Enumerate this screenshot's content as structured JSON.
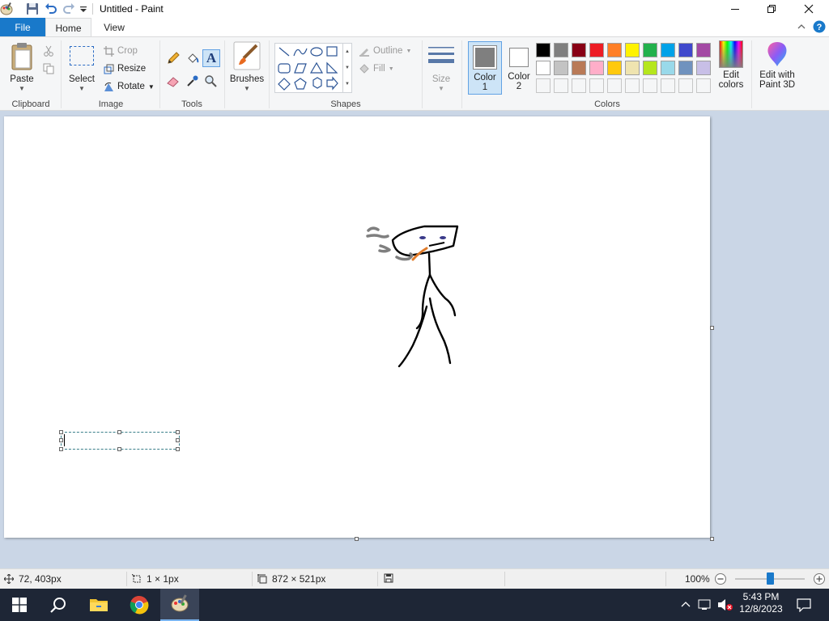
{
  "titlebar": {
    "title": "Untitled - Paint",
    "minimize_icon": "minimize-icon",
    "maximize_icon": "restore-icon",
    "close_icon": "close-icon"
  },
  "tabs": {
    "file": "File",
    "home": "Home",
    "view": "View"
  },
  "ribbon": {
    "clipboard": {
      "label": "Clipboard",
      "paste": "Paste"
    },
    "image": {
      "label": "Image",
      "select": "Select",
      "crop": "Crop",
      "resize": "Resize",
      "rotate": "Rotate"
    },
    "tools": {
      "label": "Tools"
    },
    "brushes": "Brushes",
    "shapes": {
      "label": "Shapes",
      "outline": "Outline",
      "fill": "Fill"
    },
    "size": "Size",
    "color1": {
      "line1": "Color",
      "line2": "1",
      "value": "#7f7f7f"
    },
    "color2": {
      "line1": "Color",
      "line2": "2",
      "value": "#ffffff"
    },
    "colors": {
      "label": "Colors",
      "row1": [
        "#000000",
        "#7f7f7f",
        "#880015",
        "#ed1c24",
        "#ff7f27",
        "#fff200",
        "#22b14c",
        "#00a2e8",
        "#3f48cc",
        "#a349a4"
      ],
      "row2": [
        "#ffffff",
        "#c3c3c3",
        "#b97a57",
        "#ffaec9",
        "#ffc90e",
        "#efe4b0",
        "#b5e61d",
        "#99d9ea",
        "#7092be",
        "#c8bfe7"
      ],
      "row3_count": 10
    },
    "edit_colors": {
      "line1": "Edit",
      "line2": "colors"
    },
    "edit_paint3d": {
      "line1": "Edit with",
      "line2": "Paint 3D"
    }
  },
  "statusbar": {
    "cursor_pos": "72, 403px",
    "selection_size": "1 × 1px",
    "image_size": "872 × 521px",
    "zoom": "100%",
    "zoom_level": 0.5
  },
  "taskbar": {
    "time": "5:43 PM",
    "date": "12/8/2023"
  }
}
